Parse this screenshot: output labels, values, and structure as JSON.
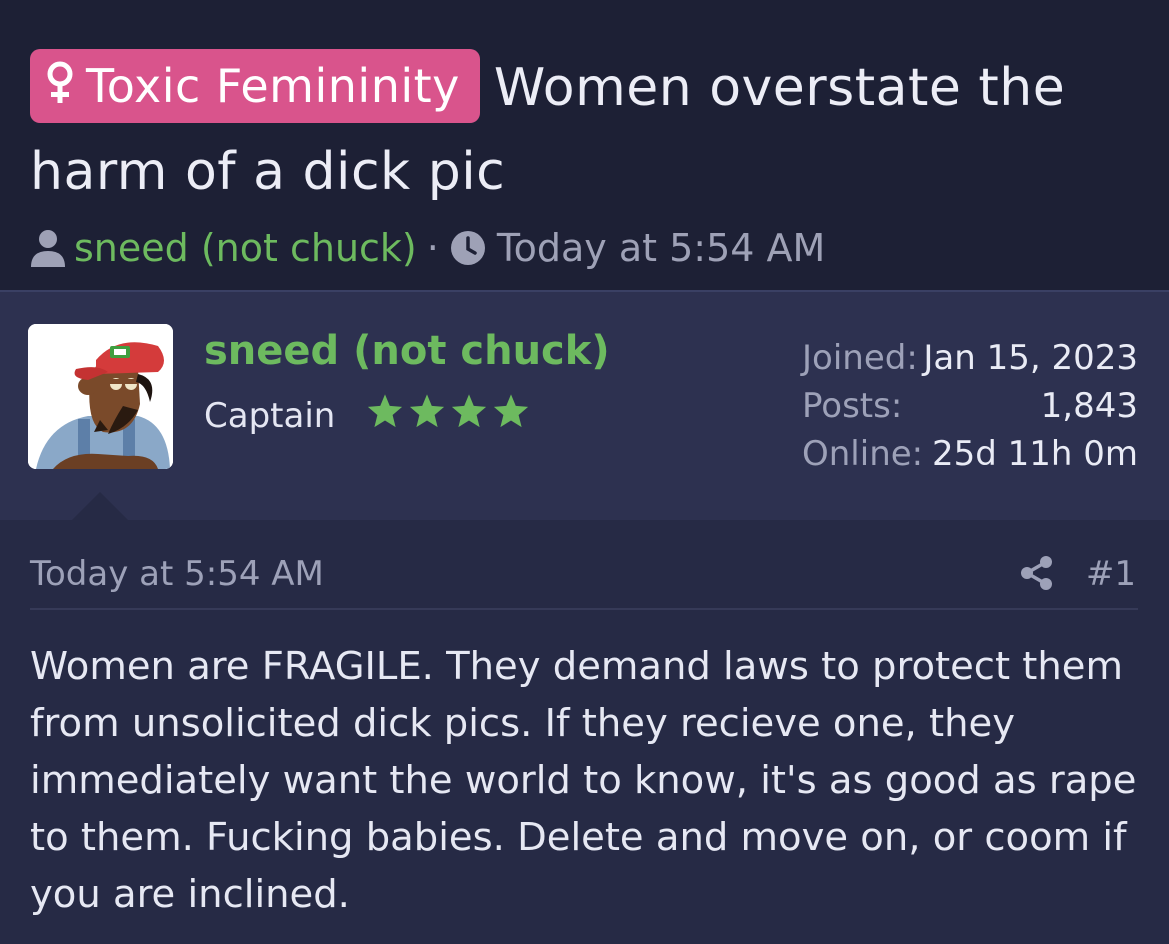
{
  "thread": {
    "prefix_label": "Toxic Femininity",
    "prefix_icon": "venus-icon",
    "prefix_color": "#d9548c",
    "title": "Women overstate the harm of a dick pic",
    "author": "sneed (not chuck)",
    "separator": "·",
    "date": "Today at 5:54 AM"
  },
  "user_card": {
    "username": "sneed (not chuck)",
    "rank": "Captain",
    "stars": 4,
    "stats": [
      {
        "label": "Joined:",
        "value": "Jan 15, 2023"
      },
      {
        "label": "Posts:",
        "value": "1,843"
      },
      {
        "label": "Online:",
        "value": "25d 11h 0m"
      }
    ]
  },
  "post": {
    "date": "Today at 5:54 AM",
    "number": "#1",
    "body": "Women are FRAGILE. They demand laws to protect them from unsolicited dick pics. If they recieve one, they immediately want the world to know, it's as good as rape to them. Fucking babies. Delete and move on, or coom if you are inclined."
  },
  "colors": {
    "background": "#1e2139",
    "username_green": "#6dba5f",
    "card_background": "#2d3150",
    "post_background": "#262a45"
  }
}
